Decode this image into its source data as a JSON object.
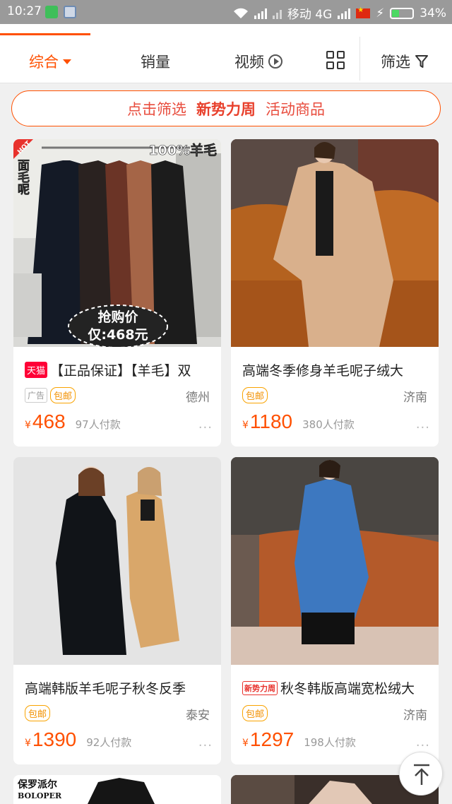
{
  "status": {
    "time": "10:27",
    "carrier": "移动 4G",
    "battery": "34%"
  },
  "tabs": {
    "comprehensive": "综合",
    "sales": "销量",
    "video": "视频",
    "filter": "筛选"
  },
  "banner": {
    "part1": "点击筛选",
    "part2": "新势力周",
    "part3": "活动商品"
  },
  "products": [
    {
      "tag": "天猫",
      "title": "【正品保证】【羊毛】双",
      "ad": "广告",
      "free_ship": "包邮",
      "location": "德州",
      "currency": "¥",
      "price": "468",
      "sold": "97人付款",
      "img_text": {
        "hot": "HOT",
        "side": "面毛呢",
        "top": "100%羊毛",
        "deal": "抢购价",
        "deal_price": "仅:468元"
      }
    },
    {
      "title": "高端冬季修身羊毛呢子绒大",
      "free_ship": "包邮",
      "location": "济南",
      "currency": "¥",
      "price": "1180",
      "sold": "380人付款"
    },
    {
      "title": "高端韩版羊毛呢子秋冬反季",
      "free_ship": "包邮",
      "location": "泰安",
      "currency": "¥",
      "price": "1390",
      "sold": "92人付款"
    },
    {
      "tag": "新势力周",
      "title": "秋冬韩版高端宽松绒大",
      "free_ship": "包邮",
      "location": "济南",
      "currency": "¥",
      "price": "1297",
      "sold": "198人付款"
    }
  ],
  "partial_card": {
    "brand_cn": "保罗派尔",
    "brand_en": "BOLOPER"
  },
  "more_label": "···"
}
